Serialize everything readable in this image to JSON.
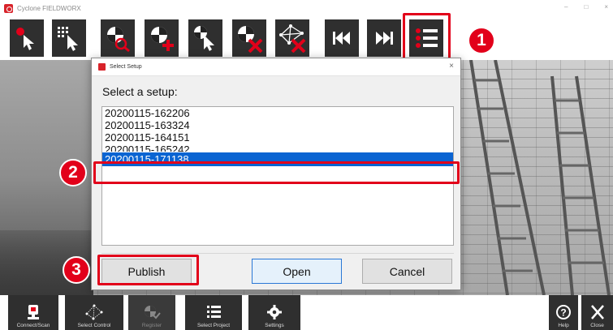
{
  "window": {
    "title": "Cyclone FIELDWORX",
    "min_glyph": "–",
    "max_glyph": "□",
    "close_glyph": "×"
  },
  "toolbar": {
    "buttons": [
      {
        "name": "touch-select",
        "icon": "hand-pointer-icon"
      },
      {
        "name": "grid-select",
        "icon": "grid-cursor-icon"
      },
      {
        "name": "zoom-target",
        "icon": "target-magnify-icon"
      },
      {
        "name": "add-target",
        "icon": "target-add-icon"
      },
      {
        "name": "select-target",
        "icon": "target-cursor-icon"
      },
      {
        "name": "delete-target",
        "icon": "target-delete-icon"
      },
      {
        "name": "delete-network",
        "icon": "network-delete-icon"
      },
      {
        "name": "first-setup",
        "icon": "skip-back-icon"
      },
      {
        "name": "last-setup",
        "icon": "skip-forward-icon"
      },
      {
        "name": "setup-list",
        "icon": "setup-list-icon"
      }
    ]
  },
  "dialog": {
    "title": "Select Setup",
    "close_glyph": "×",
    "prompt": "Select a setup:",
    "setups": [
      "20200115-162206",
      "20200115-163324",
      "20200115-164151",
      "20200115-165242"
    ],
    "selected_setup": "20200115-171138",
    "buttons": {
      "publish": "Publish",
      "open": "Open",
      "cancel": "Cancel"
    }
  },
  "callouts": {
    "one": "1",
    "two": "2",
    "three": "3"
  },
  "bottom_nav": {
    "connect_scan": "Connect/Scan",
    "select_control": "Select Control",
    "register": "Register",
    "select_project": "Select Project",
    "settings": "Settings",
    "help": "Help",
    "close": "Close"
  },
  "colors": {
    "highlight": "#e2001a",
    "selection": "#0a64d2",
    "toolbar_bg": "#2f2f2f",
    "brand": "#d8232a"
  }
}
